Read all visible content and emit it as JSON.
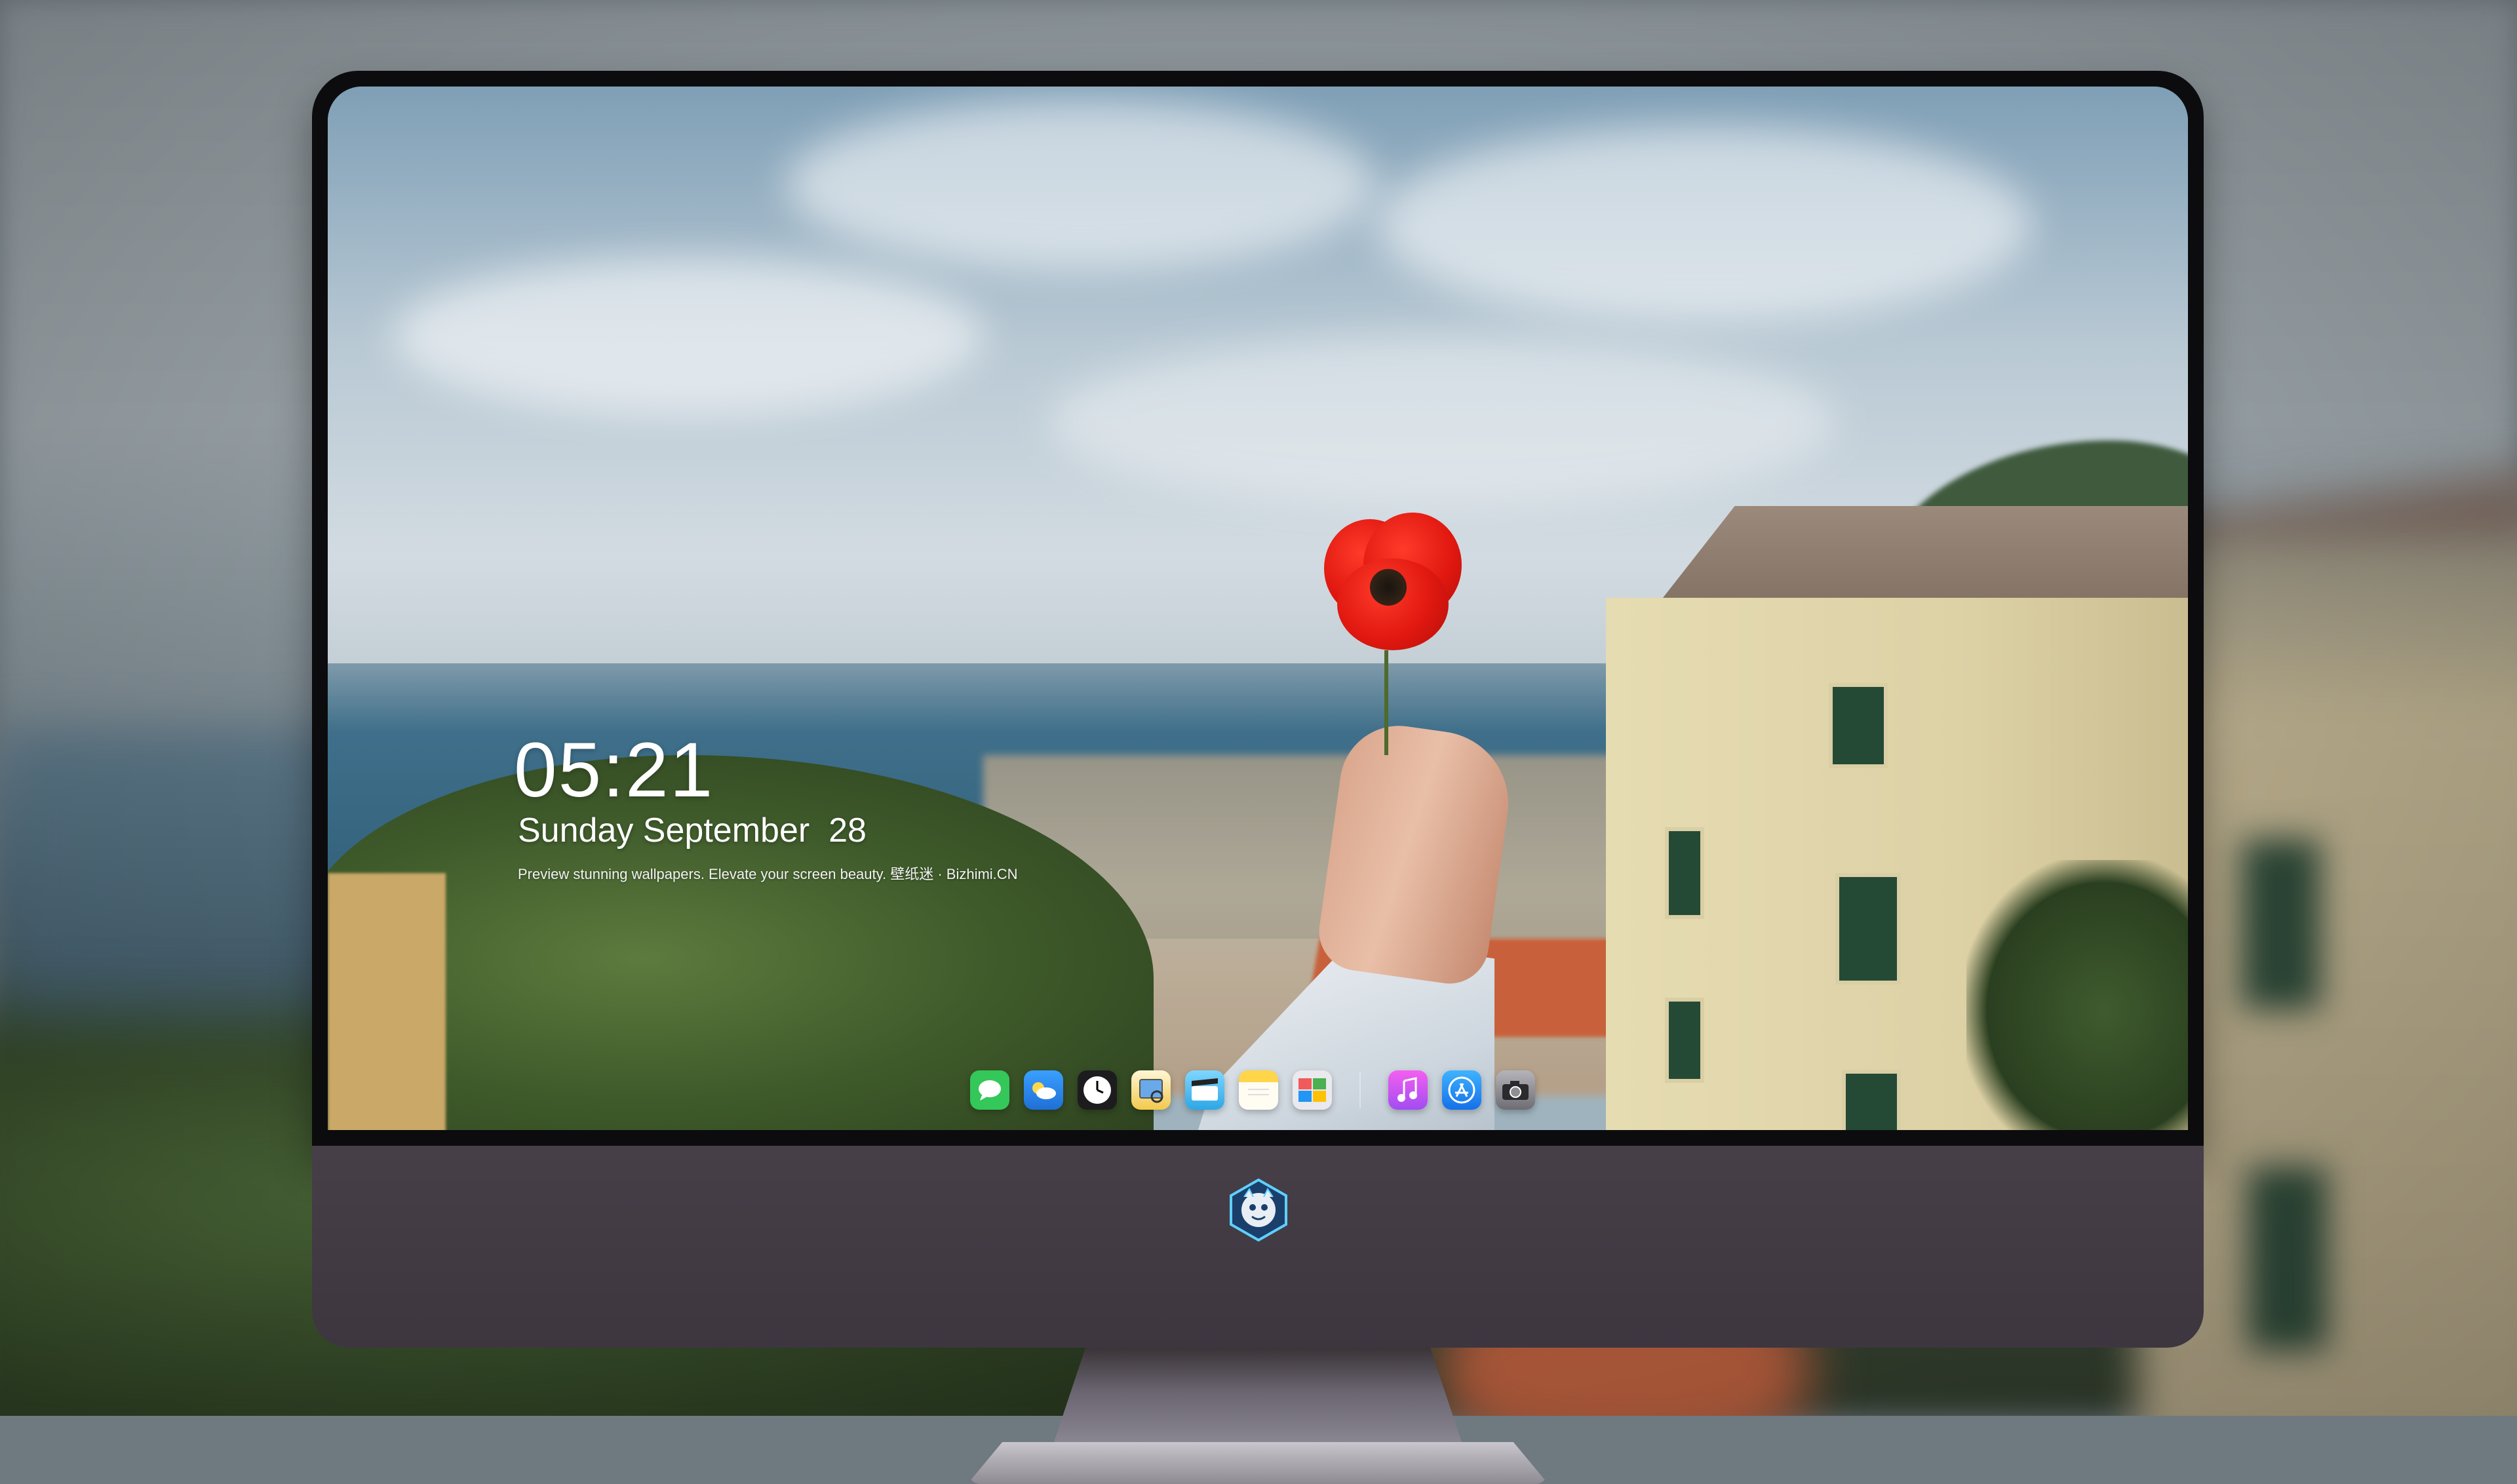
{
  "lockscreen": {
    "time": "05:21",
    "date": "Sunday September  28",
    "tagline": "Preview stunning wallpapers. Elevate your screen beauty. 壁纸迷 · Bizhimi.CN"
  },
  "dock": {
    "apps": [
      {
        "name": "messages-icon",
        "color": "#34c759"
      },
      {
        "name": "weather-icon",
        "color": "#2e8de8"
      },
      {
        "name": "clock-icon",
        "color": "#1c1c1e"
      },
      {
        "name": "preview-icon",
        "color": "#f2c94c"
      },
      {
        "name": "clips-icon",
        "color": "#5ac8fa"
      },
      {
        "name": "notes-icon",
        "color": "#ffd54a"
      },
      {
        "name": "photo-booth-icon",
        "color": "#e6e6e6"
      },
      {
        "name": "itunes-icon",
        "color": "#d55df0"
      },
      {
        "name": "app-store-icon",
        "color": "#1d8cf8"
      },
      {
        "name": "camera-icon",
        "color": "#8e8e93"
      }
    ]
  },
  "monitor": {
    "logo": "mascot-logo-icon",
    "chin_color": "#433b45"
  }
}
